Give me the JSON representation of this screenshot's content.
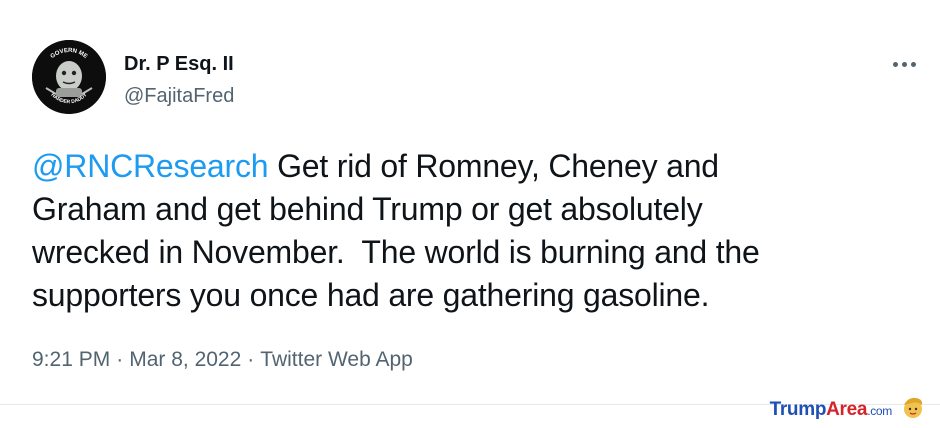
{
  "tweet": {
    "author": {
      "display_name": "Dr. P Esq. II",
      "handle": "@FajitaFred",
      "avatar_top_text": "GOVERN ME",
      "avatar_bottom_text": "HARDER DADDY"
    },
    "more_icon": "more-horizontal-icon",
    "text": {
      "mention": "@RNCResearch",
      "body": " Get rid of Romney, Cheney and\nGraham and get behind Trump or get absolutely\nwrecked in November.  The world is burning and the\nsupporters you once had are gathering gasoline."
    },
    "meta": {
      "time": "9:21 PM",
      "date": "Mar 8, 2022",
      "source": "Twitter Web App",
      "separator": "·"
    }
  },
  "watermark": {
    "part1": "Trump",
    "part2": "Area",
    "part3": ".com",
    "icon": "trump-face-icon"
  },
  "colors": {
    "link_blue": "#1d9bf0",
    "secondary_text": "#536471",
    "primary_text": "#0f1419"
  }
}
